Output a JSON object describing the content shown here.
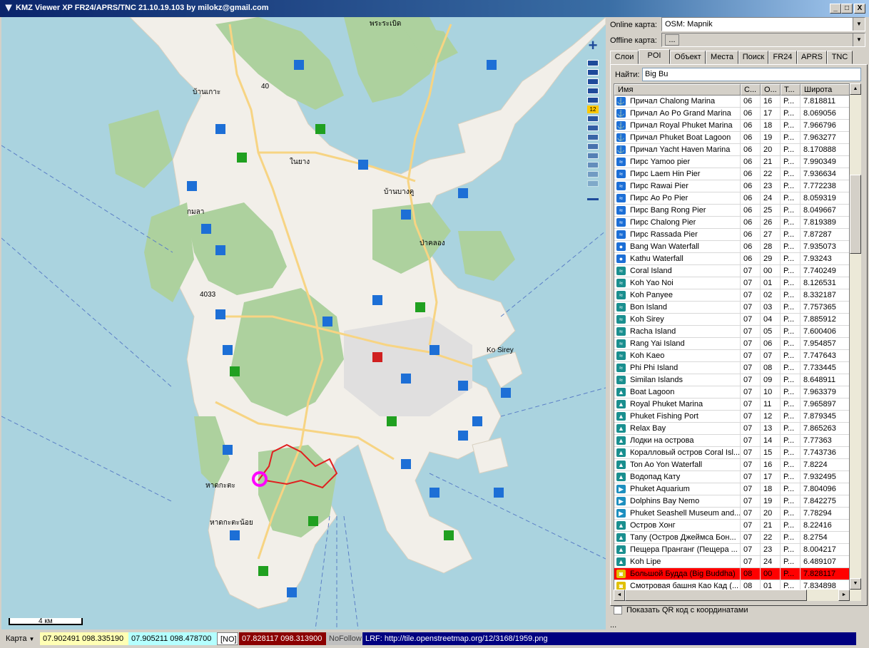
{
  "window": {
    "title": "KMZ Viewer XP FR24/APRS/TNC 21.10.19.103 by milokz@gmail.com",
    "minimize": "_",
    "maximize": "□",
    "close": "X"
  },
  "map": {
    "scale_label": "4 км",
    "zoom_plus": "+",
    "zoom_marker_label": "12",
    "labels": {
      "road_40": "40",
      "road_4033": "4033",
      "place_koh_sirey": "Ko Sirey",
      "place_1": "บ้านเกาะ",
      "place_2": "บ้านบางคู",
      "place_3": "ป่าคลอง",
      "place_4": "หาดกะตะ",
      "place_5": "หาดกะตะน้อย",
      "place_6": "กมลา",
      "place_7": "พระระเบิด",
      "place_8": "ในยาง"
    }
  },
  "panel": {
    "online_label": "Online карта:",
    "online_value": "OSM: Mapnik",
    "offline_label": "Offline карта:",
    "offline_value": "...",
    "tabs": [
      "Слои",
      "POI",
      "Объект",
      "Места",
      "Поиск",
      "FR24",
      "APRS",
      "TNC"
    ],
    "active_tab": "POI",
    "search_label": "Найти:",
    "search_value": "Big Bu",
    "columns": [
      "Имя",
      "С...",
      "О...",
      "Т...",
      "Широта"
    ],
    "qr_label": "Показать QR код с координатами",
    "ellipsis": "..."
  },
  "poi_rows": [
    {
      "name": "Причал Chalong Marina",
      "c": "06",
      "o": "16",
      "t": "P...",
      "lat": "7.818811",
      "icon": "marina"
    },
    {
      "name": "Причал Ao Po Grand Marina",
      "c": "06",
      "o": "17",
      "t": "P...",
      "lat": "8.069056",
      "icon": "marina"
    },
    {
      "name": "Причал Royal Phuket Marina",
      "c": "06",
      "o": "18",
      "t": "P...",
      "lat": "7.966796",
      "icon": "marina"
    },
    {
      "name": "Причал Phuket Boat Lagoon",
      "c": "06",
      "o": "19",
      "t": "P...",
      "lat": "7.963277",
      "icon": "marina"
    },
    {
      "name": "Причал Yacht Haven Marina",
      "c": "06",
      "o": "20",
      "t": "P...",
      "lat": "8.170888",
      "icon": "marina"
    },
    {
      "name": "Пирс Yamoo pier",
      "c": "06",
      "o": "21",
      "t": "P...",
      "lat": "7.990349",
      "icon": "pier"
    },
    {
      "name": "Пирс Laem Hin Pier",
      "c": "06",
      "o": "22",
      "t": "P...",
      "lat": "7.936634",
      "icon": "pier"
    },
    {
      "name": "Пирс Rawai Pier",
      "c": "06",
      "o": "23",
      "t": "P...",
      "lat": "7.772238",
      "icon": "pier"
    },
    {
      "name": "Пирс Ao Po Pier",
      "c": "06",
      "o": "24",
      "t": "P...",
      "lat": "8.059319",
      "icon": "pier"
    },
    {
      "name": "Пирс Bang Rong Pier",
      "c": "06",
      "o": "25",
      "t": "P...",
      "lat": "8.049667",
      "icon": "pier"
    },
    {
      "name": "Пирс Chalong Pier",
      "c": "06",
      "o": "26",
      "t": "P...",
      "lat": "7.819389",
      "icon": "pier"
    },
    {
      "name": "Пирс Rassada Pier",
      "c": "06",
      "o": "27",
      "t": "P...",
      "lat": "7.87287",
      "icon": "pier"
    },
    {
      "name": "Bang Wan Waterfall",
      "c": "06",
      "o": "28",
      "t": "P...",
      "lat": "7.935073",
      "icon": "water"
    },
    {
      "name": "Kathu Waterfall",
      "c": "06",
      "o": "29",
      "t": "P...",
      "lat": "7.93243",
      "icon": "water"
    },
    {
      "name": "Coral Island",
      "c": "07",
      "o": "00",
      "t": "P...",
      "lat": "7.740249",
      "icon": "island"
    },
    {
      "name": "Koh Yao Noi",
      "c": "07",
      "o": "01",
      "t": "P...",
      "lat": "8.126531",
      "icon": "island"
    },
    {
      "name": "Koh Panyee",
      "c": "07",
      "o": "02",
      "t": "P...",
      "lat": "8.332187",
      "icon": "island"
    },
    {
      "name": "Bon Island",
      "c": "07",
      "o": "03",
      "t": "P...",
      "lat": "7.757365",
      "icon": "island"
    },
    {
      "name": "Koh Sirey",
      "c": "07",
      "o": "04",
      "t": "P...",
      "lat": "7.885912",
      "icon": "island"
    },
    {
      "name": "Racha Island",
      "c": "07",
      "o": "05",
      "t": "P...",
      "lat": "7.600406",
      "icon": "island"
    },
    {
      "name": "Rang Yai Island",
      "c": "07",
      "o": "06",
      "t": "P...",
      "lat": "7.954857",
      "icon": "island"
    },
    {
      "name": "Koh Kaeo",
      "c": "07",
      "o": "07",
      "t": "P...",
      "lat": "7.747643",
      "icon": "island"
    },
    {
      "name": "Phi Phi Island",
      "c": "07",
      "o": "08",
      "t": "P...",
      "lat": "7.733445",
      "icon": "island"
    },
    {
      "name": "Similan Islands",
      "c": "07",
      "o": "09",
      "t": "P...",
      "lat": "8.648911",
      "icon": "island"
    },
    {
      "name": "Boat Lagoon",
      "c": "07",
      "o": "10",
      "t": "P...",
      "lat": "7.963379",
      "icon": "boat"
    },
    {
      "name": "Royal Phuket Marina",
      "c": "07",
      "o": "11",
      "t": "P...",
      "lat": "7.965897",
      "icon": "boat"
    },
    {
      "name": "Phuket Fishing Port",
      "c": "07",
      "o": "12",
      "t": "P...",
      "lat": "7.879345",
      "icon": "boat"
    },
    {
      "name": "Relax Bay",
      "c": "07",
      "o": "13",
      "t": "P...",
      "lat": "7.865263",
      "icon": "boat"
    },
    {
      "name": "Лодки на острова",
      "c": "07",
      "o": "14",
      "t": "P...",
      "lat": "7.77363",
      "icon": "boat"
    },
    {
      "name": "Коралловый остров Coral Isl...",
      "c": "07",
      "o": "15",
      "t": "P...",
      "lat": "7.743736",
      "icon": "boat"
    },
    {
      "name": "Ton Ao Yon Waterfall",
      "c": "07",
      "o": "16",
      "t": "P...",
      "lat": "7.8224",
      "icon": "boat"
    },
    {
      "name": "Водопад Кату",
      "c": "07",
      "o": "17",
      "t": "P...",
      "lat": "7.932495",
      "icon": "boat"
    },
    {
      "name": "Phuket Aquarium",
      "c": "07",
      "o": "18",
      "t": "P...",
      "lat": "7.804096",
      "icon": "fish"
    },
    {
      "name": "Dolphins Bay Nemo",
      "c": "07",
      "o": "19",
      "t": "P...",
      "lat": "7.842275",
      "icon": "fish"
    },
    {
      "name": "Phuket Seashell Museum and...",
      "c": "07",
      "o": "20",
      "t": "P...",
      "lat": "7.78294",
      "icon": "fish"
    },
    {
      "name": "Остров Хонг",
      "c": "07",
      "o": "21",
      "t": "P...",
      "lat": "8.22416",
      "icon": "boat"
    },
    {
      "name": "Тапу (Остров Джеймса Бон...",
      "c": "07",
      "o": "22",
      "t": "P...",
      "lat": "8.2754",
      "icon": "boat"
    },
    {
      "name": "Пещера Пранганг (Пещера ...",
      "c": "07",
      "o": "23",
      "t": "P...",
      "lat": "8.004217",
      "icon": "boat"
    },
    {
      "name": "Koh Lipe",
      "c": "07",
      "o": "24",
      "t": "P...",
      "lat": "6.489107",
      "icon": "boat"
    },
    {
      "name": "Большой Будда (Big Buddha)",
      "c": "08",
      "o": "00",
      "t": "P...",
      "lat": "7.828117",
      "icon": "camera",
      "selected": true
    },
    {
      "name": "Смотровая башня Као Кад (...",
      "c": "08",
      "o": "01",
      "t": "P...",
      "lat": "7.834898",
      "icon": "camera"
    }
  ],
  "status": {
    "mode": "Карта",
    "coord1": "07.902491  098.335190",
    "coord2": "07.905211  098.478700",
    "no": "[NO]",
    "coord3": "07.828117  098.313900",
    "follow": "NoFollow",
    "lrf": "LRF: http://tile.openstreetmap.org/12/3168/1959.png"
  },
  "colors": {
    "sea": "#aad3df",
    "land": "#f2efe9",
    "forest": "#add19e",
    "urban": "#e0dfdf",
    "selected_row": "#ff0000",
    "status_blue": "#000080"
  }
}
